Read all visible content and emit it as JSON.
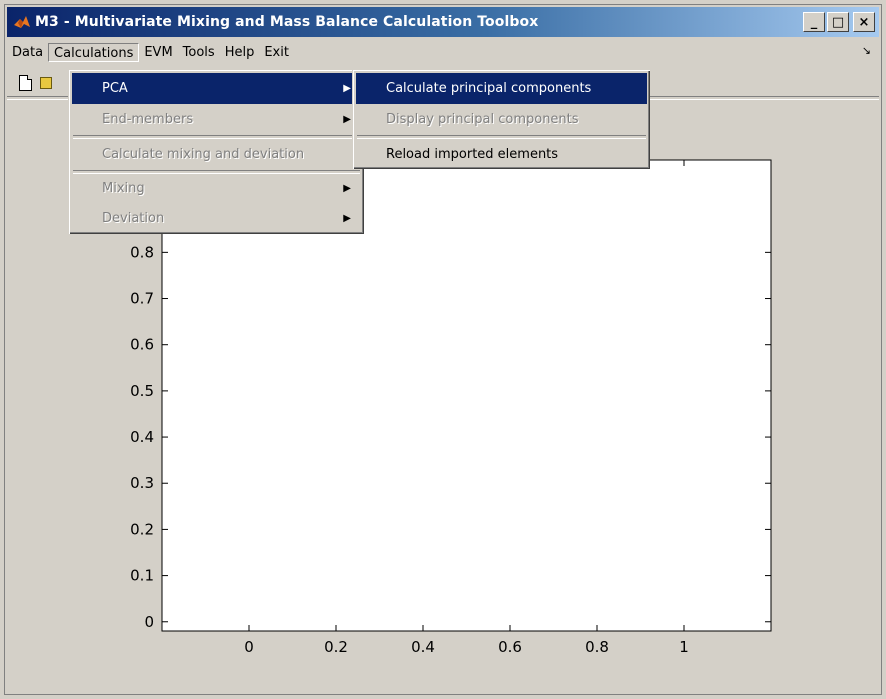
{
  "window": {
    "title": "M3 - Multivariate Mixing and Mass Balance Calculation Toolbox",
    "icon": "matlab-logo-icon",
    "buttons": {
      "minimize": "_",
      "maximize": "□",
      "close": "×"
    }
  },
  "menubar": {
    "items": [
      "Data",
      "Calculations",
      "EVM",
      "Tools",
      "Help",
      "Exit"
    ],
    "active": "Calculations"
  },
  "toolbar": {
    "icons": [
      "new-file-icon",
      "open-folder-icon"
    ]
  },
  "calculations_menu": {
    "items": [
      {
        "label": "PCA",
        "submenu": true,
        "enabled": true,
        "highlighted": true
      },
      {
        "label": "End-members",
        "submenu": true,
        "enabled": false
      },
      {
        "label": "Calculate mixing and deviation",
        "submenu": false,
        "enabled": false
      },
      {
        "label": "Mixing",
        "submenu": true,
        "enabled": false
      },
      {
        "label": "Deviation",
        "submenu": true,
        "enabled": false
      }
    ]
  },
  "pca_submenu": {
    "items": [
      {
        "label": "Calculate principal components",
        "enabled": true,
        "highlighted": true
      },
      {
        "label": "Display principal components",
        "enabled": false
      },
      {
        "label": "Reload imported elements",
        "enabled": true
      }
    ]
  },
  "chart_data": {
    "type": "scatter",
    "title": "",
    "xlabel": "",
    "ylabel": "",
    "x_ticks": [
      "0",
      "0.2",
      "0.4",
      "0.6",
      "0.8",
      "1"
    ],
    "y_ticks": [
      "0",
      "0.1",
      "0.2",
      "0.3",
      "0.4",
      "0.5",
      "0.6",
      "0.7",
      "0.8"
    ],
    "xlim": [
      -0.2,
      1.2
    ],
    "ylim": [
      -0.02,
      1.0
    ],
    "series": [],
    "grid": false
  },
  "colors": {
    "face": "#d4d0c8",
    "highlight": "#0a246a",
    "disabled": "#808080"
  }
}
